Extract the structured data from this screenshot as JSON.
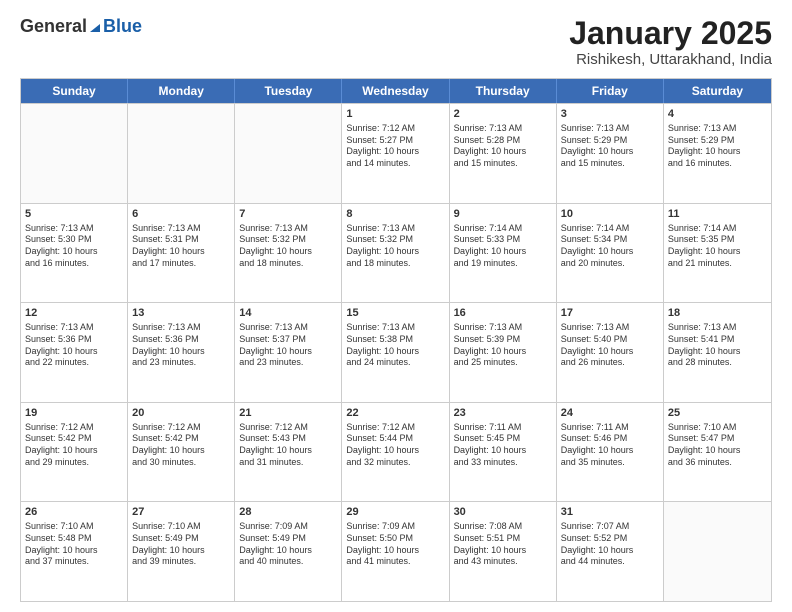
{
  "header": {
    "logo": {
      "general": "General",
      "blue": "Blue"
    },
    "title": "January 2025",
    "location": "Rishikesh, Uttarakhand, India"
  },
  "calendar": {
    "days": [
      "Sunday",
      "Monday",
      "Tuesday",
      "Wednesday",
      "Thursday",
      "Friday",
      "Saturday"
    ],
    "rows": [
      [
        {
          "date": "",
          "info": ""
        },
        {
          "date": "",
          "info": ""
        },
        {
          "date": "",
          "info": ""
        },
        {
          "date": "1",
          "info": "Sunrise: 7:12 AM\nSunset: 5:27 PM\nDaylight: 10 hours\nand 14 minutes."
        },
        {
          "date": "2",
          "info": "Sunrise: 7:13 AM\nSunset: 5:28 PM\nDaylight: 10 hours\nand 15 minutes."
        },
        {
          "date": "3",
          "info": "Sunrise: 7:13 AM\nSunset: 5:29 PM\nDaylight: 10 hours\nand 15 minutes."
        },
        {
          "date": "4",
          "info": "Sunrise: 7:13 AM\nSunset: 5:29 PM\nDaylight: 10 hours\nand 16 minutes."
        }
      ],
      [
        {
          "date": "5",
          "info": "Sunrise: 7:13 AM\nSunset: 5:30 PM\nDaylight: 10 hours\nand 16 minutes."
        },
        {
          "date": "6",
          "info": "Sunrise: 7:13 AM\nSunset: 5:31 PM\nDaylight: 10 hours\nand 17 minutes."
        },
        {
          "date": "7",
          "info": "Sunrise: 7:13 AM\nSunset: 5:32 PM\nDaylight: 10 hours\nand 18 minutes."
        },
        {
          "date": "8",
          "info": "Sunrise: 7:13 AM\nSunset: 5:32 PM\nDaylight: 10 hours\nand 18 minutes."
        },
        {
          "date": "9",
          "info": "Sunrise: 7:14 AM\nSunset: 5:33 PM\nDaylight: 10 hours\nand 19 minutes."
        },
        {
          "date": "10",
          "info": "Sunrise: 7:14 AM\nSunset: 5:34 PM\nDaylight: 10 hours\nand 20 minutes."
        },
        {
          "date": "11",
          "info": "Sunrise: 7:14 AM\nSunset: 5:35 PM\nDaylight: 10 hours\nand 21 minutes."
        }
      ],
      [
        {
          "date": "12",
          "info": "Sunrise: 7:13 AM\nSunset: 5:36 PM\nDaylight: 10 hours\nand 22 minutes."
        },
        {
          "date": "13",
          "info": "Sunrise: 7:13 AM\nSunset: 5:36 PM\nDaylight: 10 hours\nand 23 minutes."
        },
        {
          "date": "14",
          "info": "Sunrise: 7:13 AM\nSunset: 5:37 PM\nDaylight: 10 hours\nand 23 minutes."
        },
        {
          "date": "15",
          "info": "Sunrise: 7:13 AM\nSunset: 5:38 PM\nDaylight: 10 hours\nand 24 minutes."
        },
        {
          "date": "16",
          "info": "Sunrise: 7:13 AM\nSunset: 5:39 PM\nDaylight: 10 hours\nand 25 minutes."
        },
        {
          "date": "17",
          "info": "Sunrise: 7:13 AM\nSunset: 5:40 PM\nDaylight: 10 hours\nand 26 minutes."
        },
        {
          "date": "18",
          "info": "Sunrise: 7:13 AM\nSunset: 5:41 PM\nDaylight: 10 hours\nand 28 minutes."
        }
      ],
      [
        {
          "date": "19",
          "info": "Sunrise: 7:12 AM\nSunset: 5:42 PM\nDaylight: 10 hours\nand 29 minutes."
        },
        {
          "date": "20",
          "info": "Sunrise: 7:12 AM\nSunset: 5:42 PM\nDaylight: 10 hours\nand 30 minutes."
        },
        {
          "date": "21",
          "info": "Sunrise: 7:12 AM\nSunset: 5:43 PM\nDaylight: 10 hours\nand 31 minutes."
        },
        {
          "date": "22",
          "info": "Sunrise: 7:12 AM\nSunset: 5:44 PM\nDaylight: 10 hours\nand 32 minutes."
        },
        {
          "date": "23",
          "info": "Sunrise: 7:11 AM\nSunset: 5:45 PM\nDaylight: 10 hours\nand 33 minutes."
        },
        {
          "date": "24",
          "info": "Sunrise: 7:11 AM\nSunset: 5:46 PM\nDaylight: 10 hours\nand 35 minutes."
        },
        {
          "date": "25",
          "info": "Sunrise: 7:10 AM\nSunset: 5:47 PM\nDaylight: 10 hours\nand 36 minutes."
        }
      ],
      [
        {
          "date": "26",
          "info": "Sunrise: 7:10 AM\nSunset: 5:48 PM\nDaylight: 10 hours\nand 37 minutes."
        },
        {
          "date": "27",
          "info": "Sunrise: 7:10 AM\nSunset: 5:49 PM\nDaylight: 10 hours\nand 39 minutes."
        },
        {
          "date": "28",
          "info": "Sunrise: 7:09 AM\nSunset: 5:49 PM\nDaylight: 10 hours\nand 40 minutes."
        },
        {
          "date": "29",
          "info": "Sunrise: 7:09 AM\nSunset: 5:50 PM\nDaylight: 10 hours\nand 41 minutes."
        },
        {
          "date": "30",
          "info": "Sunrise: 7:08 AM\nSunset: 5:51 PM\nDaylight: 10 hours\nand 43 minutes."
        },
        {
          "date": "31",
          "info": "Sunrise: 7:07 AM\nSunset: 5:52 PM\nDaylight: 10 hours\nand 44 minutes."
        },
        {
          "date": "",
          "info": ""
        }
      ]
    ]
  }
}
